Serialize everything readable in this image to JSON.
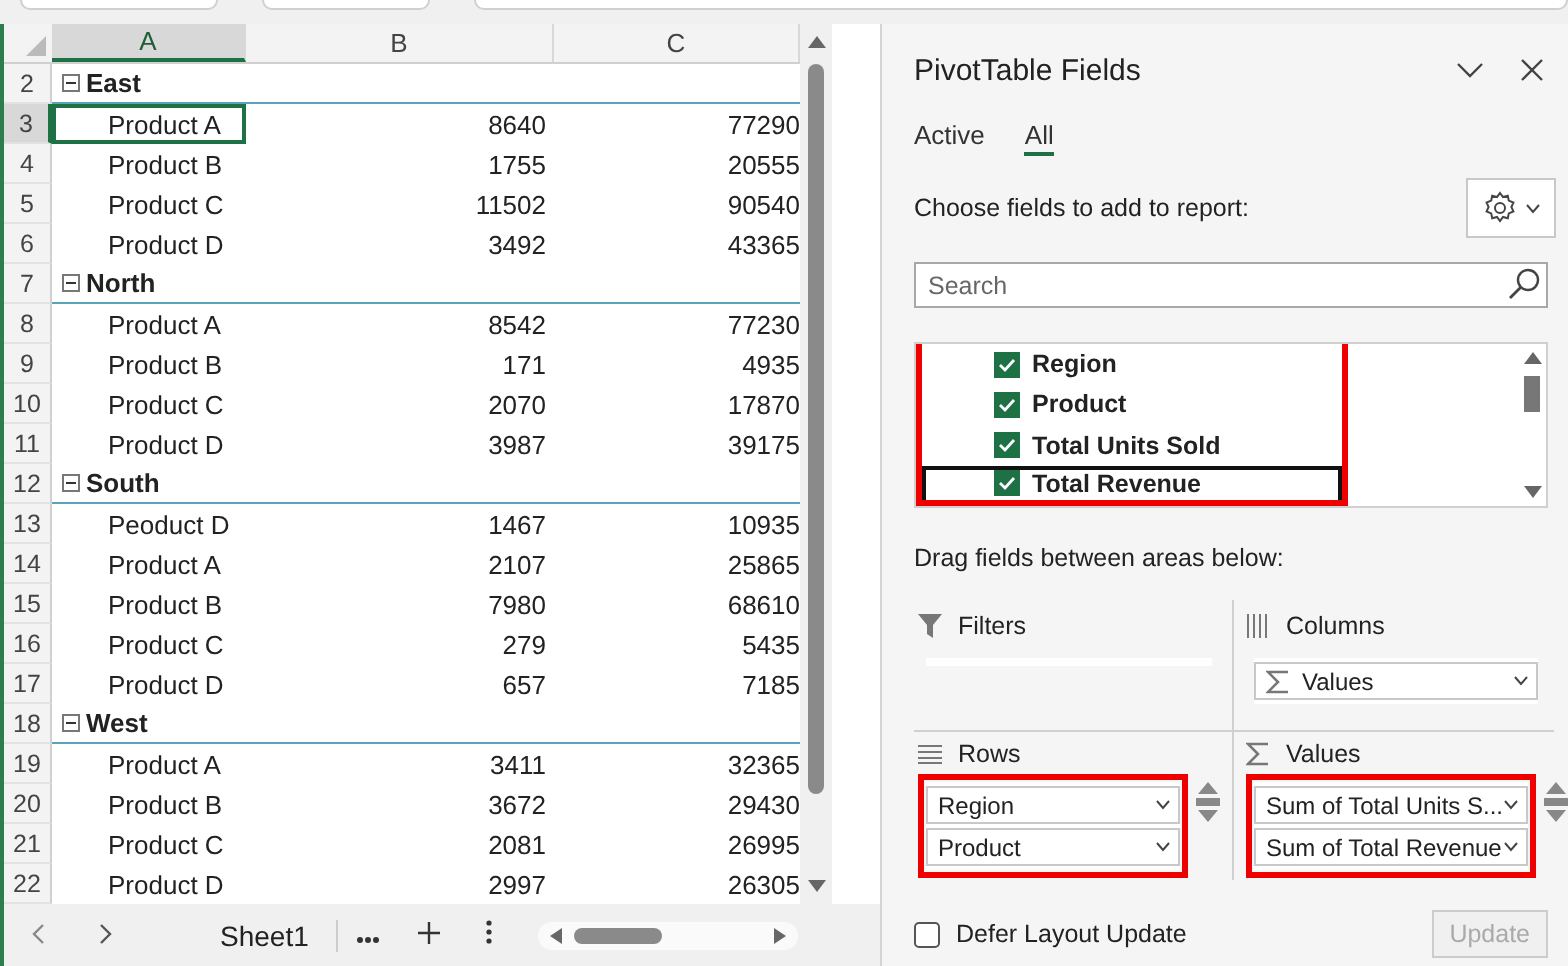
{
  "spreadsheet": {
    "column_headers": [
      {
        "label": "A",
        "selected": true
      },
      {
        "label": "B",
        "selected": false
      },
      {
        "label": "C",
        "selected": false
      }
    ],
    "rows": [
      {
        "number": "2",
        "kind": "group",
        "label": "East",
        "expanded": true,
        "selected": false
      },
      {
        "number": "3",
        "kind": "item",
        "label": "Product A",
        "units": "8640",
        "revenue": "77290",
        "selected": true
      },
      {
        "number": "4",
        "kind": "item",
        "label": "Product B",
        "units": "1755",
        "revenue": "20555",
        "selected": false
      },
      {
        "number": "5",
        "kind": "item",
        "label": "Product C",
        "units": "11502",
        "revenue": "90540",
        "selected": false
      },
      {
        "number": "6",
        "kind": "item",
        "label": "Product D",
        "units": "3492",
        "revenue": "43365",
        "selected": false
      },
      {
        "number": "7",
        "kind": "group",
        "label": "North",
        "expanded": true,
        "selected": false
      },
      {
        "number": "8",
        "kind": "item",
        "label": "Product A",
        "units": "8542",
        "revenue": "77230",
        "selected": false
      },
      {
        "number": "9",
        "kind": "item",
        "label": "Product B",
        "units": "171",
        "revenue": "4935",
        "selected": false
      },
      {
        "number": "10",
        "kind": "item",
        "label": "Product C",
        "units": "2070",
        "revenue": "17870",
        "selected": false
      },
      {
        "number": "11",
        "kind": "item",
        "label": "Product D",
        "units": "3987",
        "revenue": "39175",
        "selected": false
      },
      {
        "number": "12",
        "kind": "group",
        "label": "South",
        "expanded": true,
        "selected": false
      },
      {
        "number": "13",
        "kind": "item",
        "label": "Peoduct D",
        "units": "1467",
        "revenue": "10935",
        "selected": false
      },
      {
        "number": "14",
        "kind": "item",
        "label": "Product A",
        "units": "2107",
        "revenue": "25865",
        "selected": false
      },
      {
        "number": "15",
        "kind": "item",
        "label": "Product B",
        "units": "7980",
        "revenue": "68610",
        "selected": false
      },
      {
        "number": "16",
        "kind": "item",
        "label": "Product C",
        "units": "279",
        "revenue": "5435",
        "selected": false
      },
      {
        "number": "17",
        "kind": "item",
        "label": "Product D",
        "units": "657",
        "revenue": "7185",
        "selected": false
      },
      {
        "number": "18",
        "kind": "group",
        "label": "West",
        "expanded": true,
        "selected": false
      },
      {
        "number": "19",
        "kind": "item",
        "label": "Product A",
        "units": "3411",
        "revenue": "32365",
        "selected": false
      },
      {
        "number": "20",
        "kind": "item",
        "label": "Product B",
        "units": "3672",
        "revenue": "29430",
        "selected": false
      },
      {
        "number": "21",
        "kind": "item",
        "label": "Product C",
        "units": "2081",
        "revenue": "26995",
        "selected": false
      },
      {
        "number": "22",
        "kind": "item",
        "label": "Product D",
        "units": "2997",
        "revenue": "26305",
        "selected": false
      }
    ],
    "sheet_tabs": [
      {
        "label": "Sheet1",
        "selected": true
      }
    ]
  },
  "pivot_panel": {
    "title": "PivotTable Fields",
    "tabs": [
      {
        "label": "Active",
        "selected": false
      },
      {
        "label": "All",
        "selected": true
      }
    ],
    "instruction": "Choose fields to add to report:",
    "search": {
      "placeholder": "Search"
    },
    "fields": {
      "highlighted": true,
      "items": [
        {
          "label": "Region",
          "checked": true
        },
        {
          "label": "Product",
          "checked": true
        },
        {
          "label": "Total Units Sold",
          "checked": true
        },
        {
          "label": "Total Revenue",
          "checked": true
        }
      ]
    },
    "drag_hint": "Drag fields between areas below:",
    "areas": [
      {
        "kind": "filters",
        "label": "Filters",
        "highlighted": false
      },
      {
        "kind": "columns",
        "label": "Columns",
        "highlighted": false,
        "items": [
          "Values"
        ]
      },
      {
        "kind": "rows",
        "label": "Rows",
        "highlighted": true,
        "items": [
          "Region",
          "Product"
        ]
      },
      {
        "kind": "values",
        "label": "Values",
        "highlighted": true,
        "items": [
          "Sum of Total Units S...",
          "Sum of Total Revenue"
        ]
      }
    ],
    "defer_update": {
      "label": "Defer Layout Update",
      "checked": false
    },
    "update_button": {
      "label": "Update",
      "disabled": true
    }
  }
}
